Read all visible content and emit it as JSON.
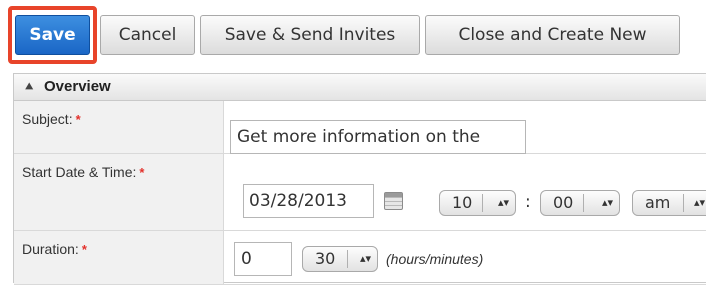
{
  "toolbar": {
    "save_label": "Save",
    "cancel_label": "Cancel",
    "save_send_label": "Save & Send Invites",
    "close_create_label": "Close and Create New",
    "highlight_color": "#e8442a",
    "primary_color": "#1a66c6"
  },
  "panel": {
    "title": "Overview",
    "collapse_icon": "double-chevron-up-icon"
  },
  "fields": {
    "subject": {
      "label": "Subject:",
      "required": "*",
      "value": "Get more information on the"
    },
    "start": {
      "label": "Start Date & Time:",
      "required": "*",
      "date": "03/28/2013",
      "calendar_icon": "calendar-icon",
      "hour": "10",
      "minute": "00",
      "separator": ":",
      "meridiem": "am"
    },
    "duration": {
      "label": "Duration:",
      "required": "*",
      "hours": "0",
      "minutes": "30",
      "hint": "(hours/minutes)"
    }
  },
  "spinner_glyph": "▴▾"
}
